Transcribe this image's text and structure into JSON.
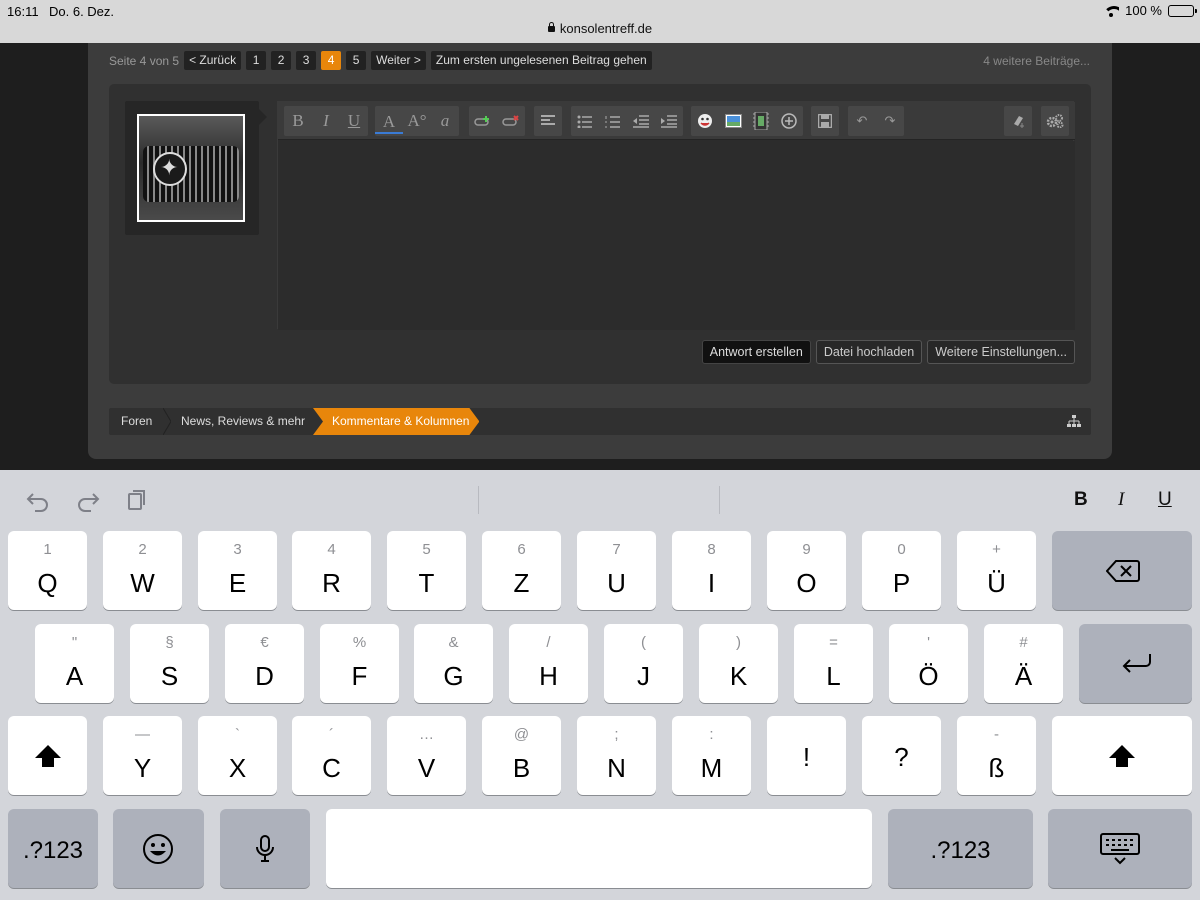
{
  "status_bar": {
    "time": "16:11",
    "date": "Do. 6. Dez.",
    "url": "konsolentreff.de",
    "battery": "100 %"
  },
  "pagination": {
    "label": "Seite 4 von 5",
    "prev": "< Zurück",
    "pages": [
      "1",
      "2",
      "3",
      "4",
      "5"
    ],
    "current_page": "4",
    "next": "Weiter >",
    "first_unread": "Zum ersten ungelesenen Beitrag gehen",
    "more_posts": "4 weitere Beiträge..."
  },
  "editor": {
    "toolbar_icons": [
      "bold-icon",
      "italic-icon",
      "underline-icon",
      "font-color-icon",
      "font-size-icon",
      "font-family-icon",
      "insert-link-icon",
      "remove-link-icon",
      "align-icon",
      "bullet-list-icon",
      "numbered-list-icon",
      "outdent-icon",
      "indent-icon",
      "smilie-icon",
      "image-icon",
      "media-icon",
      "insert-more-icon",
      "save-draft-icon",
      "undo-icon",
      "redo-icon",
      "remove-formatting-icon",
      "settings-icon"
    ],
    "toolbar_glyphs": {
      "bold": "B",
      "italic": "I",
      "underline": "U",
      "font_color": "A",
      "font_size": "A°",
      "font_family": "a"
    }
  },
  "actions": {
    "reply": "Antwort erstellen",
    "upload": "Datei hochladen",
    "more_options": "Weitere Einstellungen..."
  },
  "breadcrumb": {
    "items": [
      "Foren",
      "News, Reviews & mehr",
      "Kommentare & Kolumnen"
    ]
  },
  "colors": {
    "accent": "#e8860b",
    "panel": "#3c3c3c",
    "keyboard": "#d3d5da"
  },
  "keyboard": {
    "format": {
      "bold": "B",
      "italic": "I",
      "underline": "U"
    },
    "row1": [
      {
        "main": "Q",
        "sub": "1"
      },
      {
        "main": "W",
        "sub": "2"
      },
      {
        "main": "E",
        "sub": "3"
      },
      {
        "main": "R",
        "sub": "4"
      },
      {
        "main": "T",
        "sub": "5"
      },
      {
        "main": "Z",
        "sub": "6"
      },
      {
        "main": "U",
        "sub": "7"
      },
      {
        "main": "I",
        "sub": "8"
      },
      {
        "main": "O",
        "sub": "9"
      },
      {
        "main": "P",
        "sub": "0"
      },
      {
        "main": "Ü",
        "sub": "+"
      }
    ],
    "row2": [
      {
        "main": "A",
        "sub": "\""
      },
      {
        "main": "S",
        "sub": "§"
      },
      {
        "main": "D",
        "sub": "€"
      },
      {
        "main": "F",
        "sub": "%"
      },
      {
        "main": "G",
        "sub": "&"
      },
      {
        "main": "H",
        "sub": "/"
      },
      {
        "main": "J",
        "sub": "("
      },
      {
        "main": "K",
        "sub": ")"
      },
      {
        "main": "L",
        "sub": "="
      },
      {
        "main": "Ö",
        "sub": "'"
      },
      {
        "main": "Ä",
        "sub": "#"
      }
    ],
    "row3": [
      {
        "main": "Y",
        "sub": "—"
      },
      {
        "main": "X",
        "sub": "`"
      },
      {
        "main": "C",
        "sub": "´"
      },
      {
        "main": "V",
        "sub": "…"
      },
      {
        "main": "B",
        "sub": "@"
      },
      {
        "main": "N",
        "sub": ";"
      },
      {
        "main": "M",
        "sub": ":"
      },
      {
        "main": "!",
        "sub": ""
      },
      {
        "main": "?",
        "sub": ""
      },
      {
        "main": "ß",
        "sub": "-"
      }
    ],
    "numbers_label": ".?123"
  }
}
